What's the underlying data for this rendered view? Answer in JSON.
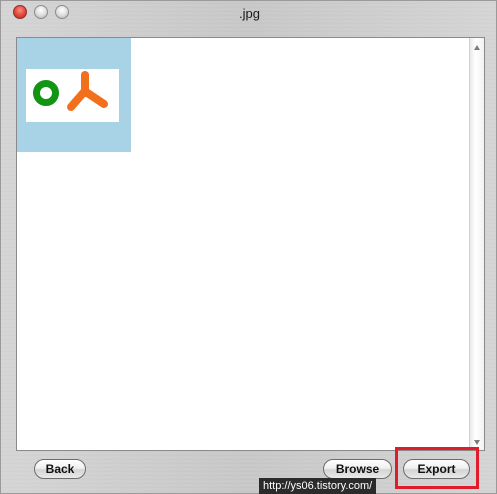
{
  "window": {
    "title": ".jpg"
  },
  "buttons": {
    "back": "Back",
    "browse": "Browse",
    "export": "Export"
  },
  "watermark": "http://ys06.tistory.com/",
  "colors": {
    "thumbnail_bg": "#a8d3e7",
    "logo_green": "#129512",
    "logo_orange": "#f2701c",
    "highlight": "#e01b2a"
  }
}
